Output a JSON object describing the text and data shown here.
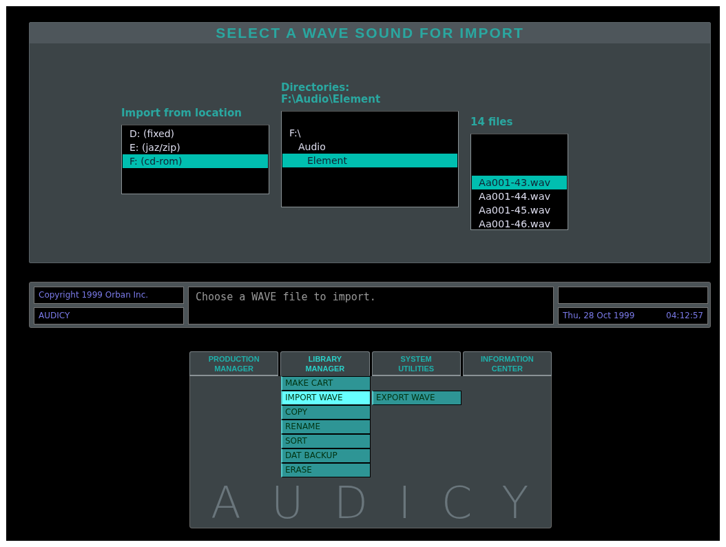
{
  "window": {
    "title": "SELECT A WAVE SOUND FOR IMPORT"
  },
  "locations": {
    "label": "Import from location",
    "items": [
      {
        "label": "D: (fixed)",
        "selected": false
      },
      {
        "label": "E: (jaz/zip)",
        "selected": false
      },
      {
        "label": "F: (cd-rom)",
        "selected": true
      }
    ]
  },
  "directories": {
    "label": "Directories:",
    "path": "F:\\Audio\\Element",
    "tree": [
      {
        "label": "F:\\",
        "selected": false,
        "children": [
          {
            "label": "Audio",
            "selected": false,
            "children": [
              {
                "label": "Element",
                "selected": true
              }
            ]
          }
        ]
      }
    ]
  },
  "files": {
    "label": "14 files",
    "items": [
      {
        "label": "Aa001-43.wav",
        "selected": true
      },
      {
        "label": "Aa001-44.wav",
        "selected": false
      },
      {
        "label": "Aa001-45.wav",
        "selected": false
      },
      {
        "label": "Aa001-46.wav",
        "selected": false
      }
    ]
  },
  "status_bar": {
    "copyright": "Copyright 1999 Orban Inc.",
    "product": "AUDICY",
    "message": "Choose a WAVE file to import.",
    "date": "Thu, 28 Oct 1999",
    "time": "04:12:57"
  },
  "menu": {
    "tabs": [
      {
        "label": "PRODUCTION MANAGER",
        "selected": false
      },
      {
        "label": "LIBRARY MANAGER",
        "selected": true
      },
      {
        "label": "SYSTEM UTILITIES",
        "selected": false
      },
      {
        "label": "INFORMATION CENTER",
        "selected": false
      }
    ],
    "items": [
      {
        "label": "MAKE CART",
        "selected": false
      },
      {
        "label": "IMPORT WAVE",
        "selected": true
      },
      {
        "label": "COPY",
        "selected": false
      },
      {
        "label": "RENAME",
        "selected": false
      },
      {
        "label": "SORT",
        "selected": false
      },
      {
        "label": "DAT BACKUP",
        "selected": false
      },
      {
        "label": "ERASE",
        "selected": false
      }
    ],
    "submenu": [
      {
        "label": "EXPORT WAVE",
        "selected": false
      }
    ],
    "logo_text": "AUDICY"
  }
}
